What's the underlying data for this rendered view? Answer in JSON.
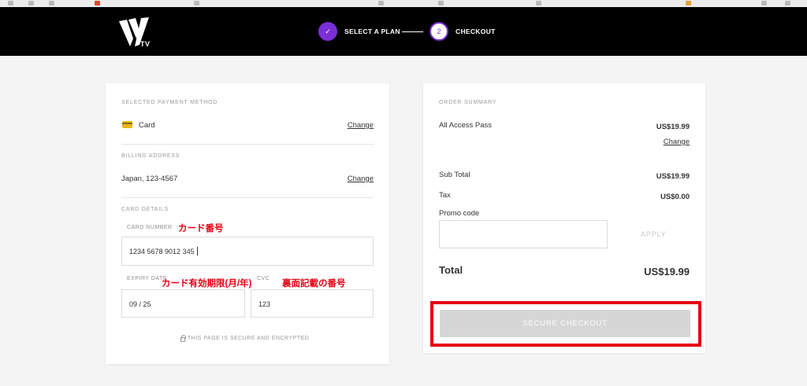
{
  "header": {
    "logo_text": "TV",
    "steps": [
      {
        "number": "✓",
        "label": "SELECT A PLAN"
      },
      {
        "number": "2",
        "label": "CHECKOUT"
      }
    ]
  },
  "payment": {
    "title": "SELECTED PAYMENT METHOD",
    "method": "Card",
    "change": "Change",
    "billing_title": "BILLING ADDRESS",
    "billing_value": "Japan, 123-4567",
    "billing_change": "Change",
    "card_details_title": "CARD DETAILS",
    "card_number_label": "CARD NUMBER",
    "card_number_value": "1234 5678 9012 345",
    "expiry_label": "EXPIRY DATE",
    "expiry_value": "09 / 25",
    "cvc_label": "CVC",
    "cvc_value": "123",
    "secure_note": "THIS PAGE IS SECURE AND ENCRYPTED"
  },
  "annotations": {
    "card_number": "カード番号",
    "expiry": "カード有効期限(月/年)",
    "cvc": "裏面記載の番号"
  },
  "summary": {
    "title": "ORDER SUMMARY",
    "item_name": "All Access Pass",
    "item_price": "US$19.99",
    "item_change": "Change",
    "subtotal_label": "Sub Total",
    "subtotal_value": "US$19.99",
    "tax_label": "Tax",
    "tax_value": "US$0.00",
    "promo_label": "Promo code",
    "promo_value": "",
    "apply_label": "APPLY",
    "total_label": "Total",
    "total_value": "US$19.99",
    "checkout_label": "SECURE CHECKOUT"
  },
  "colors": {
    "accent": "#7b2fd6",
    "annotation": "#e60012",
    "header_bg": "#000000"
  }
}
